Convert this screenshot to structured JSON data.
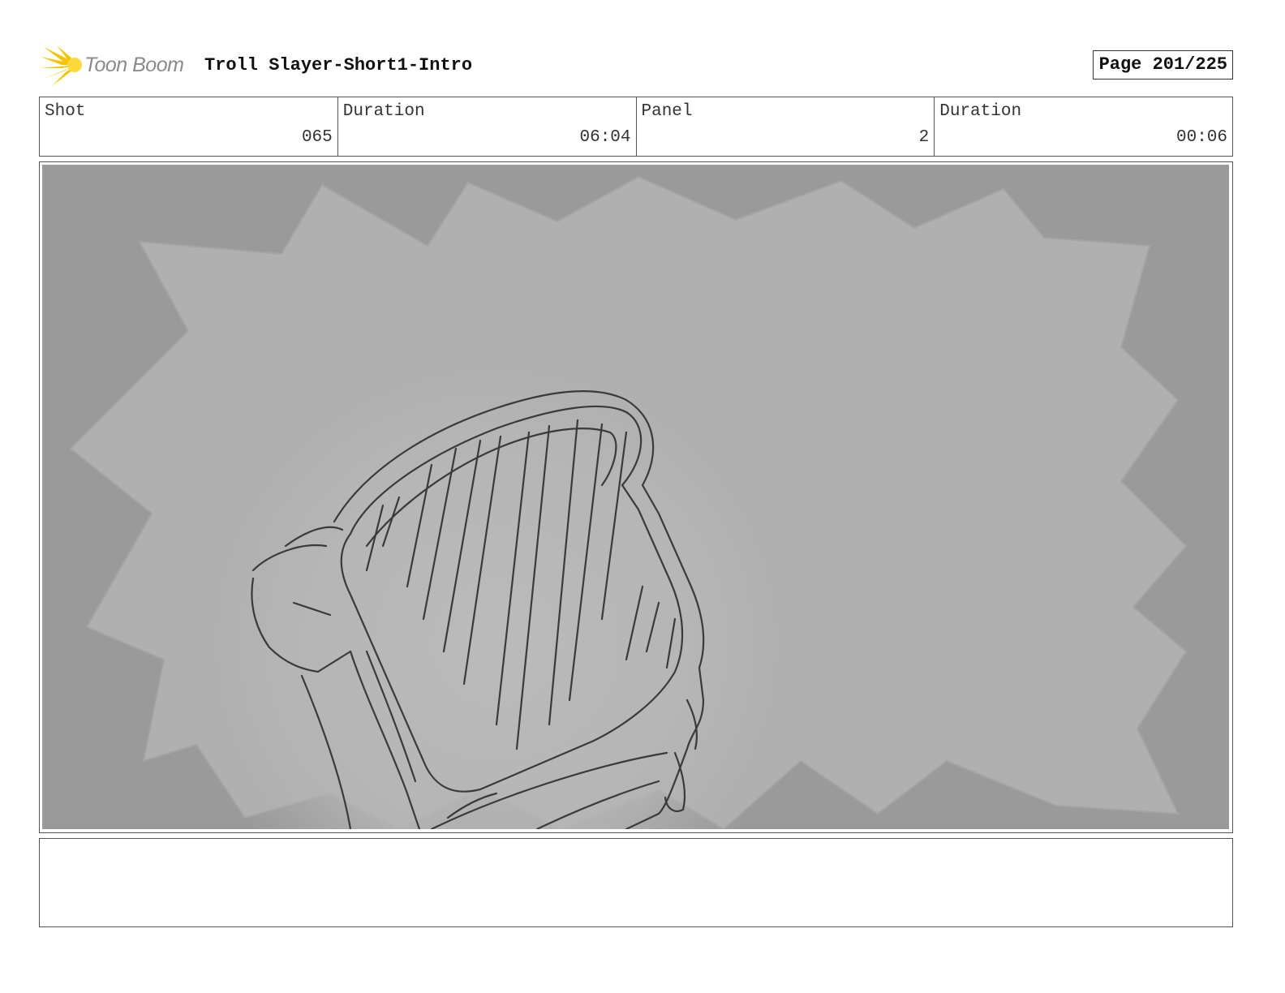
{
  "header": {
    "logo_text": "Toon Boom",
    "project_title": "Troll Slayer-Short1-Intro",
    "page_label": "Page 201/225"
  },
  "info": {
    "shot_label": "Shot",
    "shot_value": "065",
    "shot_duration_label": "Duration",
    "shot_duration_value": "06:04",
    "panel_label": "Panel",
    "panel_value": "2",
    "panel_duration_label": "Duration",
    "panel_duration_value": "00:06"
  },
  "notes": {
    "text": ""
  },
  "colors": {
    "logo_accent": "#f5c400",
    "panel_background": "#9a9a9a",
    "burst_fill": "#b0b0b0",
    "sketch_line": "#3a3a3a"
  }
}
